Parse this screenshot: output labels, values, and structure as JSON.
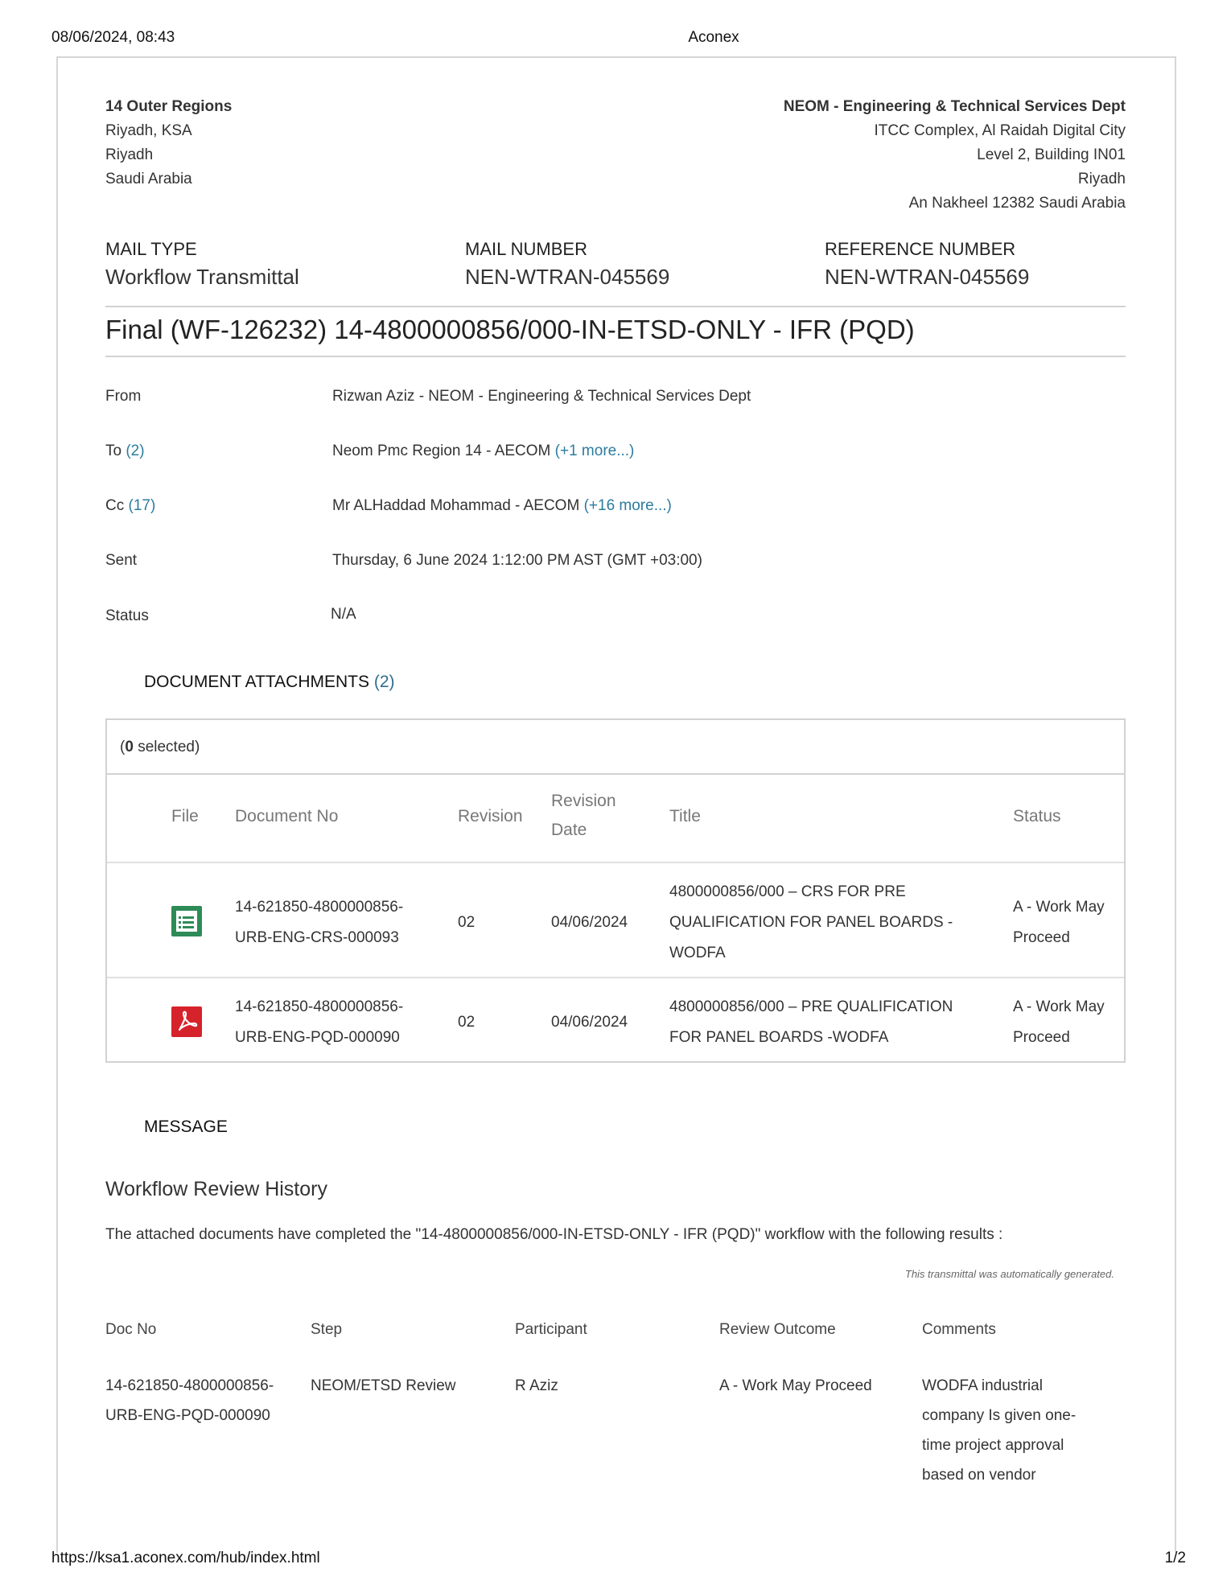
{
  "print_header": {
    "date": "08/06/2024, 08:43",
    "title": "Aconex"
  },
  "print_footer": {
    "url": "https://ksa1.aconex.com/hub/index.html",
    "page": "1/2"
  },
  "sender_address": {
    "name": "14 Outer Regions",
    "lines": [
      "Riyadh, KSA",
      "Riyadh",
      "Saudi Arabia"
    ]
  },
  "recipient_address": {
    "name": "NEOM - Engineering & Technical Services Dept",
    "lines": [
      "ITCC Complex, Al Raidah Digital City",
      "Level 2, Building IN01",
      "Riyadh",
      "An Nakheel 12382 Saudi Arabia"
    ]
  },
  "mail_meta": {
    "mail_type_label": "MAIL TYPE",
    "mail_type": "Workflow Transmittal",
    "mail_number_label": "MAIL NUMBER",
    "mail_number": "NEN-WTRAN-045569",
    "reference_number_label": "REFERENCE NUMBER",
    "reference_number": "NEN-WTRAN-045569"
  },
  "subject": "Final (WF-126232) 14-4800000856/000-IN-ETSD-ONLY - IFR (PQD)",
  "fields": {
    "from_label": "From",
    "from_value": "Rizwan Aziz - NEOM - Engineering & Technical Services Dept",
    "to_label": "To",
    "to_count": "(2)",
    "to_value": "Neom Pmc Region 14 - AECOM",
    "to_more": "(+1 more...)",
    "cc_label": "Cc",
    "cc_count": "(17)",
    "cc_value": "Mr ALHaddad Mohammad - AECOM",
    "cc_more": "(+16 more...)",
    "sent_label": "Sent",
    "sent_value": "Thursday, 6 June 2024 1:12:00 PM AST (GMT +03:00)",
    "status_label": "Status",
    "status_value": "N/A"
  },
  "attachments": {
    "title": "DOCUMENT ATTACHMENTS",
    "count": "(2)",
    "selected_open": "(",
    "selected_count": "0",
    "selected_text": "selected)",
    "headers": {
      "file": "File",
      "doc_no": "Document No",
      "revision": "Revision",
      "revision_date_1": "Revision",
      "revision_date_2": "Date",
      "title": "Title",
      "status": "Status"
    },
    "rows": [
      {
        "icon": "spreadsheet-icon",
        "doc_no_1": "14-621850-4800000856-",
        "doc_no_2": "URB-ENG-CRS-000093",
        "revision": "02",
        "revision_date": "04/06/2024",
        "title_1": "4800000856/000 – CRS FOR PRE",
        "title_2": "QUALIFICATION FOR PANEL BOARDS -",
        "title_3": "WODFA",
        "status_1": "A - Work May",
        "status_2": "Proceed"
      },
      {
        "icon": "pdf-icon",
        "doc_no_1": "14-621850-4800000856-",
        "doc_no_2": "URB-ENG-PQD-000090",
        "revision": "02",
        "revision_date": "04/06/2024",
        "title_1": "4800000856/000 – PRE QUALIFICATION",
        "title_2": "FOR PANEL BOARDS -WODFA",
        "status_1": "A - Work May",
        "status_2": "Proceed"
      }
    ]
  },
  "message": {
    "title": "MESSAGE",
    "heading": "Workflow Review History",
    "text": "The attached documents have completed the \"14-4800000856/000-IN-ETSD-ONLY - IFR (PQD)\" workflow with the following results :",
    "note": "This transmittal was automatically generated.",
    "history_headers": {
      "doc_no": "Doc No",
      "step": "Step",
      "participant": "Participant",
      "outcome": "Review Outcome",
      "comments": "Comments"
    },
    "history_rows": [
      {
        "doc_no_1": "14-621850-4800000856-",
        "doc_no_2": "URB-ENG-PQD-000090",
        "step": "NEOM/ETSD Review",
        "participant": "R Aziz",
        "outcome": "A - Work May Proceed",
        "comments_1": "WODFA industrial",
        "comments_2": "company Is given one-",
        "comments_3": "time project approval",
        "comments_4": "based on vendor"
      }
    ]
  }
}
